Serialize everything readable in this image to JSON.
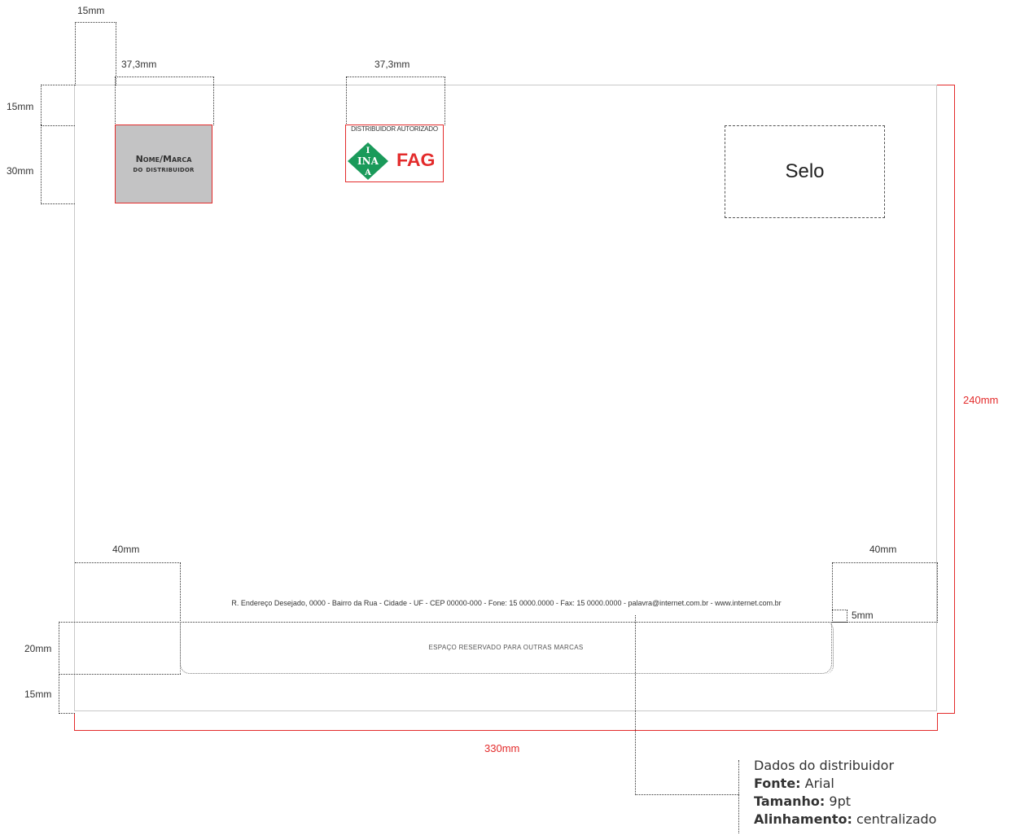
{
  "dimensions": {
    "top_margin": "15mm",
    "logo_width_left": "37,3mm",
    "logo_width_center": "37,3mm",
    "header_top": "15mm",
    "header_height": "30mm",
    "page_height": "240mm",
    "footer_left_width": "40mm",
    "footer_right_width": "40mm",
    "address_gap": "5mm",
    "reserved_height": "20mm",
    "bottom_margin": "15mm",
    "page_width": "330mm"
  },
  "brand_box": {
    "line1": "Nome/Marca",
    "line2": "do distribuidor"
  },
  "distributor": {
    "title": "DISTRIBUIDOR AUTORIZADO",
    "ina_logo": "INA",
    "fag_logo": "FAG"
  },
  "seal": {
    "label": "Selo"
  },
  "address_line": "R. Endereço Desejado, 0000 - Bairro da Rua - Cidade - UF - CEP 00000-000 - Fone: 15 0000.0000 - Fax: 15  0000.0000 - palavra@internet.com.br - www.internet.com.br",
  "reserved_area": {
    "label": "ESPAÇO RESERVADO PARA OUTRAS MARCAS"
  },
  "notes": {
    "title": "Dados do distribuidor",
    "font_key": "Fonte:",
    "font_value": "Arial",
    "size_key": "Tamanho:",
    "size_value": "9pt",
    "align_key": "Alinhamento:",
    "align_value": "centralizado"
  },
  "colors": {
    "accent": "#e32b2b",
    "ina_green": "#1a9a5a",
    "placeholder_gray": "#c3c3c4"
  }
}
